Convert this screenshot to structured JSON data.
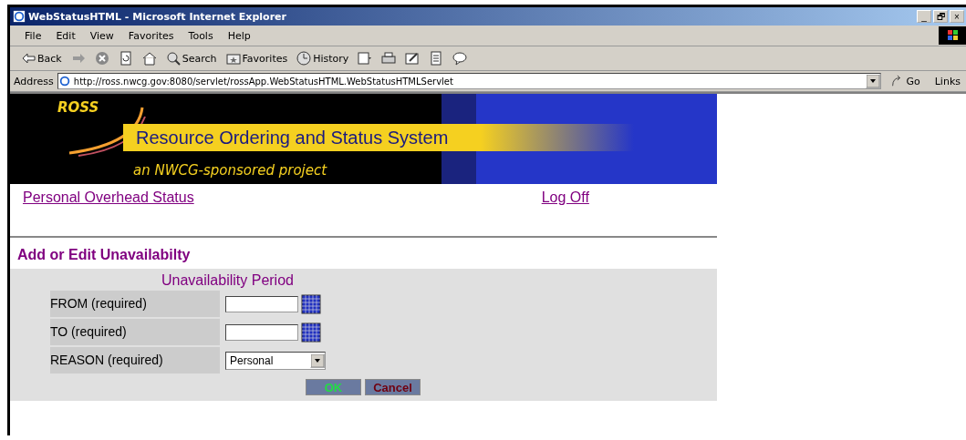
{
  "window": {
    "title": "WebStatusHTML - Microsoft Internet Explorer",
    "controls": [
      "_",
      "🗗",
      "×"
    ]
  },
  "menu": [
    "File",
    "Edit",
    "View",
    "Favorites",
    "Tools",
    "Help"
  ],
  "toolbar": [
    {
      "kind": "back",
      "label": "Back"
    },
    {
      "kind": "forward"
    },
    {
      "kind": "stop"
    },
    {
      "kind": "refresh"
    },
    {
      "kind": "home"
    },
    {
      "kind": "search",
      "label": "Search"
    },
    {
      "kind": "favorites",
      "label": "Favorites"
    },
    {
      "kind": "history",
      "label": "History"
    },
    {
      "kind": "mail"
    },
    {
      "kind": "print"
    },
    {
      "kind": "edit"
    },
    {
      "kind": "discuss"
    },
    {
      "kind": "messenger"
    }
  ],
  "address": {
    "label": "Address",
    "url": "http://ross.nwcg.gov:8080/servlet/rossApp.WebStatusHTML.WebStatusHTMLServlet",
    "go": "Go",
    "links": "Links"
  },
  "banner": {
    "logo": "ROSS",
    "title": "Resource Ordering and Status System",
    "subtitle": "an NWCG-sponsored project"
  },
  "nav": {
    "left": "Personal Overhead Status",
    "right": "Log Off"
  },
  "heading": "Add or Edit Unavailabilty",
  "form": {
    "title": "Unavailability Period",
    "fields": [
      {
        "label": "FROM (required)",
        "kind": "date"
      },
      {
        "label": "TO (required)",
        "kind": "date"
      },
      {
        "label": "REASON (required)",
        "kind": "select",
        "value": "Personal"
      }
    ],
    "buttons": [
      {
        "label": "OK",
        "kind": "ok"
      },
      {
        "label": "Cancel",
        "kind": "cancel"
      }
    ]
  }
}
